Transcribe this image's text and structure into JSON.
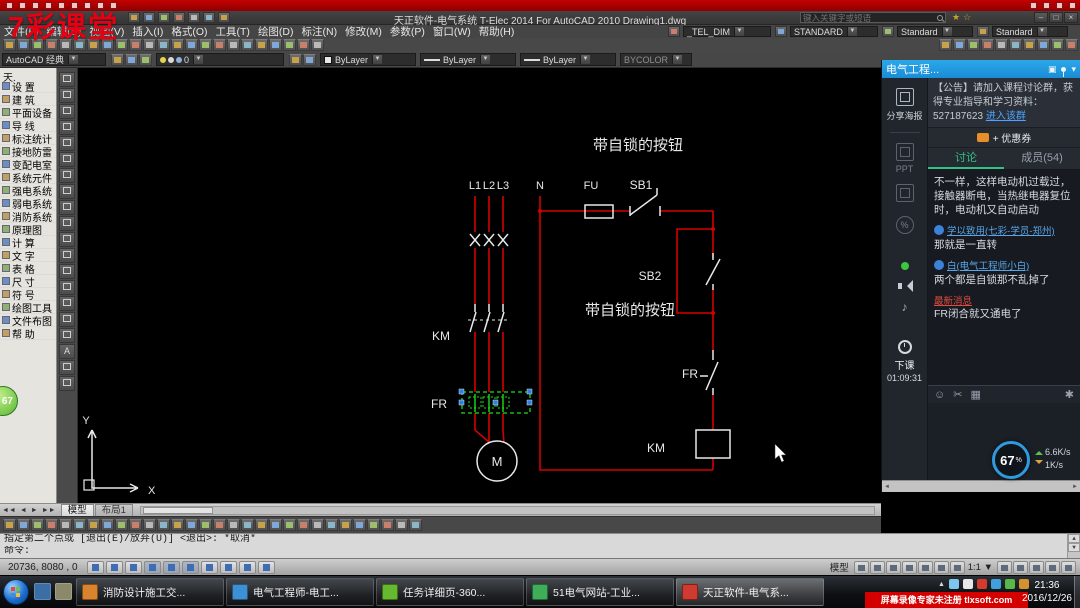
{
  "watermark": "7彩课堂",
  "colors": {
    "wire_red": "#d40000",
    "selection_green": "#16e016",
    "chat_header_blue": "#1f9ce0",
    "notice_red": "#d40000",
    "toolbar_icon_tints": [
      "#c8a24a",
      "#7fa7d8",
      "#9bbf6a",
      "#c97f6a",
      "#b9b9b9",
      "#8ab6c9"
    ],
    "sidebar_icon_tints": [
      "#6a8fc0",
      "#c0a060",
      "#8fb070"
    ],
    "app_icon_colors": [
      "#d8842f",
      "#3f8fd4",
      "#66b92e",
      "#3fae58",
      "#cf3b30"
    ],
    "quick_icon_colors": [
      "#3a6ea5",
      "#8a8a6a"
    ],
    "tray_icon_colors": [
      "#7ec6ef",
      "#e8e8e8",
      "#d43b2f",
      "#3fa0dd",
      "#58b847",
      "#d4922f"
    ],
    "orb_colors": [
      "#e04b3c",
      "#6fc24a",
      "#3f8fd4",
      "#e8c23a"
    ]
  },
  "recorder": {
    "left_icons": [
      "menu",
      "open",
      "save",
      "record",
      "pause",
      "stop",
      "play",
      "settings",
      "help"
    ],
    "right_icons": [
      "minimize",
      "restore",
      "pin",
      "close"
    ]
  },
  "titlebar": {
    "title": "天正软件-电气系统 T-Elec 2014  For AutoCAD 2010   Drawing1.dwg",
    "search_placeholder": "键入关键字或短语",
    "qat_icons": [
      "app-menu",
      "new-file",
      "open-file",
      "save",
      "undo",
      "redo",
      "plot"
    ],
    "window_buttons": [
      "–",
      "□",
      "×"
    ]
  },
  "menubar": {
    "menus": [
      "文件(F)",
      "编辑(E)",
      "视图(V)",
      "插入(I)",
      "格式(O)",
      "工具(T)",
      "绘图(D)",
      "标注(N)",
      "修改(M)",
      "参数(P)",
      "窗口(W)",
      "帮助(H)"
    ],
    "dim_style": "_TEL_DIM",
    "text_style": "STANDARD",
    "table_style": "Standard",
    "mleader_style": "Standard"
  },
  "toolbar2": {
    "left_icons": [
      "new-file",
      "open-file",
      "save",
      "plot",
      "plot-preview",
      "publish",
      "cut",
      "copy",
      "paste",
      "match-properties",
      "undo",
      "redo",
      "pan",
      "zoom-realtime",
      "zoom-window",
      "zoom-previous",
      "properties",
      "design-center",
      "tool-palettes",
      "sheet-set-manager",
      "markup-set-manager",
      "quick-calc",
      "help"
    ],
    "right_icons": [
      "osnap-settings",
      "dim-linear",
      "dim-angular",
      "table",
      "multiline-text",
      "layer-manager",
      "make-block",
      "insert-block",
      "hatch",
      "options"
    ]
  },
  "toolbar3": {
    "workspace": "AutoCAD 经典",
    "workspace_icons": [
      "workspace-settings",
      "move-gizmo",
      "ucs-icon"
    ],
    "layer": "0",
    "layer_icons": [
      "layer-properties",
      "layer-states"
    ],
    "color": "ByLayer",
    "linetype": "ByLayer",
    "lineweight": "ByLayer",
    "plot_style": "BYCOLOR"
  },
  "sidebar": {
    "header": "天.",
    "items": [
      "设 置",
      "建 筑",
      "平面设备",
      "导 线",
      "标注统计",
      "接地防雷",
      "变配电室",
      "系统元件",
      "强电系统",
      "弱电系统",
      "消防系统",
      "原理图",
      "计 算",
      "文 字",
      "表 格",
      "尺 寸",
      "符 号",
      "绘图工具",
      "文件布图",
      "帮 助"
    ]
  },
  "lefttools": {
    "icons": [
      "line",
      "construction-line",
      "polyline",
      "polygon",
      "rectangle",
      "arc",
      "circle",
      "revision-cloud",
      "spline",
      "ellipse",
      "ellipse-arc",
      "insert-block",
      "make-block",
      "point",
      "hatch",
      "gradient",
      "region",
      "text",
      "table",
      "grip-edit"
    ]
  },
  "canvas": {
    "texts": {
      "note_top": "带自锁的按钮",
      "note_mid": "带自锁的按钮",
      "l1": "L1",
      "l2": "L2",
      "l3": "L3",
      "n": "N",
      "fu": "FU",
      "sb1": "SB1",
      "sb2": "SB2",
      "km_main": "KM",
      "fr_main": "FR",
      "fr_ctrl": "FR",
      "km_coil": "KM",
      "motor": "M",
      "ucs_x": "X",
      "ucs_y": "Y"
    }
  },
  "tabsbar": {
    "nav": [
      "◄◄",
      "◄",
      "►",
      "►►"
    ],
    "tabs": [
      "模型",
      "布局1"
    ]
  },
  "toolbar_bottom": {
    "icons": [
      "draw-order",
      "line",
      "construction-line",
      "polyline",
      "polygon",
      "rectangle",
      "arc",
      "circle",
      "revision-cloud",
      "spline",
      "ellipse",
      "insert-block",
      "make-block",
      "point",
      "hatch",
      "gradient",
      "region",
      "table",
      "multiline-text",
      "erase",
      "copy",
      "mirror",
      "offset",
      "array",
      "move",
      "rotate",
      "scale",
      "stretch",
      "trim",
      "extend"
    ]
  },
  "command": {
    "line1": "指定第二个点或 [退出(E)/放弃(U)] <退出>:  *取消*",
    "line2": "命令:"
  },
  "statusbar": {
    "coords": "20736, 8080 , 0",
    "toggles": [
      "snap",
      "grid",
      "ortho",
      "polar",
      "osnap",
      "otrack",
      "ducs",
      "dyn",
      "lwt",
      "qp"
    ],
    "pressed": [
      3,
      4,
      5
    ],
    "model_label": "模型",
    "scale": "1:1",
    "right_icons": [
      "model-space",
      "quick-view-layouts",
      "quick-view-drawings",
      "pan-tool",
      "zoom-tool",
      "steering-wheel",
      "show-motion"
    ],
    "far_right_icons": [
      "annotation-visibility",
      "annotation-autoscale",
      "workspace-switching",
      "toolbar-lock",
      "clean-screen"
    ]
  },
  "taskbar": {
    "apps": [
      "消防设计施工交...",
      "电气工程师-电工...",
      "任务详细页-360...",
      "51电气网站-工业...",
      "天正软件-电气系..."
    ],
    "active_app_index": 4,
    "recorder_notice": "屏幕录像专家未注册 tlxsoft.com",
    "time": "21:36",
    "date": "2016/12/26"
  },
  "chat": {
    "title": "电气工程...",
    "header_icons": [
      "popup",
      "pin",
      "collapse"
    ],
    "announcement": "【公告】请加入课程讨论群，获得专业指导和学习资料：527187623 ",
    "announcement_link": "进入该群",
    "coupon_label": "+ 优惠券",
    "tabs": {
      "discuss": "讨论",
      "members": "成员(54)"
    },
    "rail": {
      "share": "分享海报",
      "ppt": "PPT",
      "end_class": "下课",
      "timer": "01:09:31"
    },
    "messages": [
      {
        "text": "不一样，这样电动机过载过，接触器断电，当热继电器复位时，电动机又自动启动"
      },
      {
        "name": "学以致用(七彩-学员-郑州)",
        "text": "那就是一直转"
      },
      {
        "name": "白(电气工程师小白)",
        "text": "两个都是自锁那不乱掉了"
      },
      {
        "tag": "最新消息",
        "text": "FR闭合就又通电了"
      }
    ],
    "input_icons": [
      "emoji",
      "screenshot",
      "image",
      "settings"
    ],
    "net": {
      "percent": "67",
      "unit": "%",
      "up": "6.6K/s",
      "down": "1K/s"
    }
  },
  "badge": {
    "value": "67"
  }
}
